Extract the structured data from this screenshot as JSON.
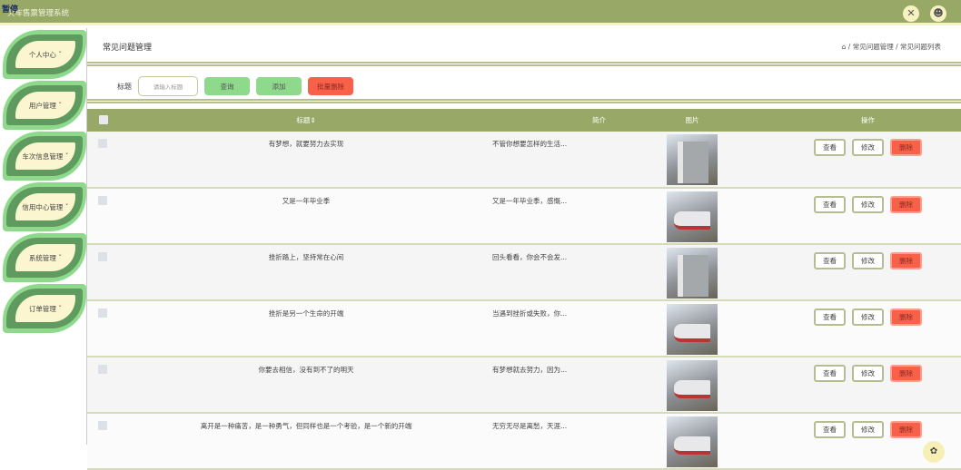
{
  "header": {
    "title": "火车售票管理系统",
    "overlay": "暂停",
    "fullscreen_icon": "fullscreen-icon",
    "user_icon": "user-icon"
  },
  "sidebar": {
    "items": [
      {
        "label": "个人中心 ˇ"
      },
      {
        "label": "用户管理 ˇ"
      },
      {
        "label": "车次信息管理 ˇ"
      },
      {
        "label": "信用中心管理 ˇ"
      },
      {
        "label": "系统管理 ˇ"
      },
      {
        "label": "订单管理 ˇ"
      }
    ]
  },
  "page": {
    "title": "常见问题管理",
    "breadcrumb": "⌂ / 常见问题管理 / 常见问题列表"
  },
  "search": {
    "label": "标题",
    "placeholder": "请输入标题",
    "query": "查询",
    "add": "添加",
    "batch_delete": "批量删除"
  },
  "table": {
    "headers": {
      "title": "标题⇕",
      "intro": "简介",
      "image": "图片",
      "ops": "操作"
    },
    "actions": {
      "view": "查看",
      "edit": "修改",
      "delete": "删除"
    },
    "rows": [
      {
        "title": "有梦想，就要努力去实现",
        "intro": "不管你想要怎样的生活..."
      },
      {
        "title": "又是一年毕业季",
        "intro": "又是一年毕业季，感慨..."
      },
      {
        "title": "挫折路上，坚持常在心间",
        "intro": "回头看看，你会不会发..."
      },
      {
        "title": "挫折是另一个生命的开端",
        "intro": "当遇到挫折或失败，你..."
      },
      {
        "title": "你要去相信，没有到不了的明天",
        "intro": "有梦想就去努力，因为..."
      },
      {
        "title": "离开是一种痛苦，是一种勇气，但同样也是一个考验，是一个新的开端",
        "intro": "无穷无尽是离愁，天涯..."
      }
    ]
  }
}
